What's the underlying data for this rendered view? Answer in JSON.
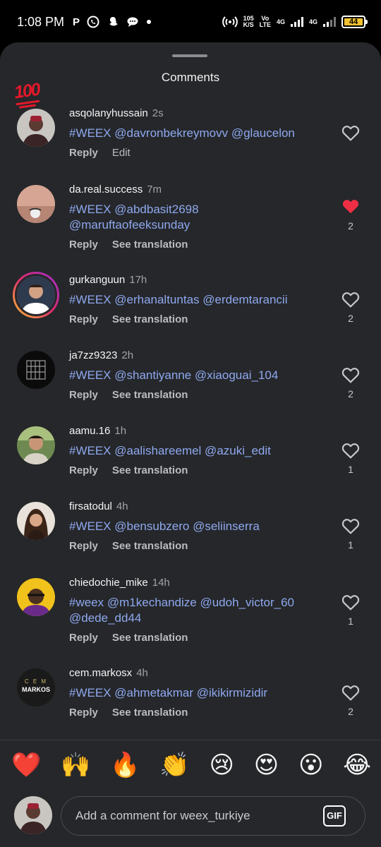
{
  "status_bar": {
    "time": "1:08 PM",
    "apps": [
      "P"
    ],
    "net_speed_value": "105",
    "net_speed_unit": "K/S",
    "vo": "Vo",
    "lte": "LTE",
    "net_4g_a": "4G",
    "net_4g_b": "4G",
    "battery": "44"
  },
  "sheet": {
    "title": "Comments"
  },
  "comments": [
    {
      "user": "asqolanyhussain",
      "ago": "2s",
      "text": "#WEEX @davronbekreymovv @glaucelon",
      "action1": "Reply",
      "action2": "Edit",
      "likes": "",
      "liked": false
    },
    {
      "user": "da.real.success",
      "ago": "7m",
      "text": "#WEEX @abdbasit2698 @maruftaofeeksunday",
      "action1": "Reply",
      "action2": "See translation",
      "likes": "2",
      "liked": true
    },
    {
      "user": "gurkanguun",
      "ago": "17h",
      "text": "#WEEX @erhanaltuntas @erdemtarancii",
      "action1": "Reply",
      "action2": "See translation",
      "likes": "2",
      "liked": false
    },
    {
      "user": "ja7zz9323",
      "ago": "2h",
      "text": "#WEEX @shantiyanne @xiaoguai_104",
      "action1": "Reply",
      "action2": "See translation",
      "likes": "2",
      "liked": false
    },
    {
      "user": "aamu.16",
      "ago": "1h",
      "text": "#WEEX @aalishareemel @azuki_edit",
      "action1": "Reply",
      "action2": "See translation",
      "likes": "1",
      "liked": false
    },
    {
      "user": "firsatodul",
      "ago": "4h",
      "text": "#WEEX @bensubzero @seliinserra",
      "action1": "Reply",
      "action2": "See translation",
      "likes": "1",
      "liked": false
    },
    {
      "user": "chiedochie_mike",
      "ago": "14h",
      "text": "#weex  @m1kechandize @udoh_victor_60 @dede_dd44",
      "action1": "Reply",
      "action2": "See translation",
      "likes": "1",
      "liked": false
    },
    {
      "user": "cem.markosx",
      "ago": "4h",
      "text": "#WEEX @ahmetakmar @ikikirmizidir",
      "action1": "Reply",
      "action2": "See translation",
      "likes": "2",
      "liked": false
    }
  ],
  "avatar_text": {
    "cem_line1": "C E M",
    "cem_line2": "MARKOS"
  },
  "reactions": [
    "❤️",
    "🙌",
    "🔥",
    "👏",
    "😢",
    "😍",
    "😮",
    "😂"
  ],
  "composer": {
    "placeholder": "Add a comment for weex_turkiye",
    "gif_label": "GIF"
  },
  "colors": {
    "sheet_bg": "#25272a",
    "mention": "#8fa8ef",
    "liked_heart": "#ed2f45"
  }
}
